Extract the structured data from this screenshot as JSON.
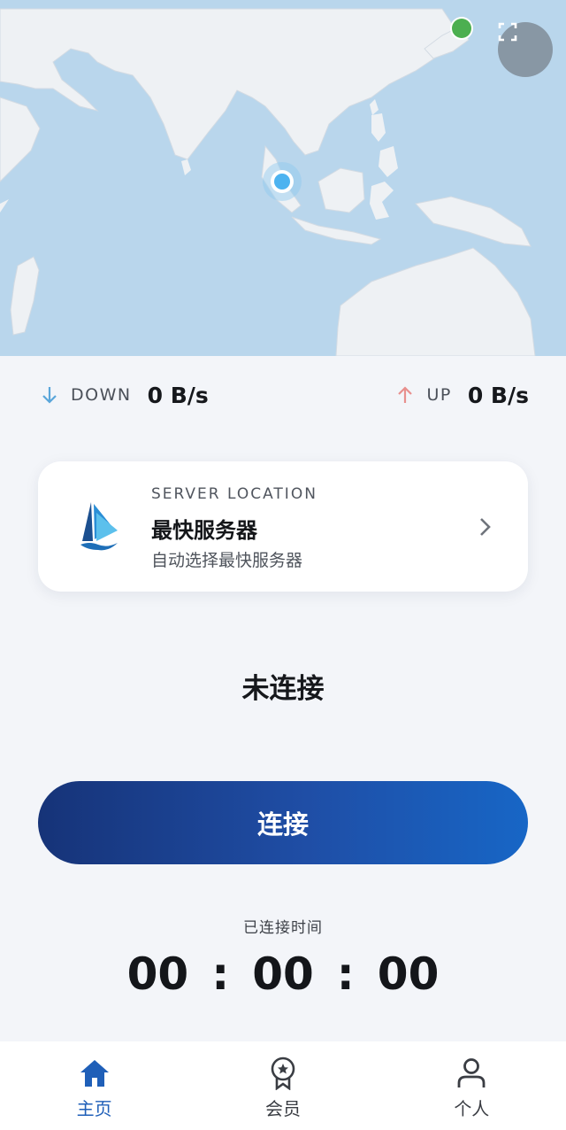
{
  "colors": {
    "accent": "#1f5fb8",
    "map_water": "#b9d6ec",
    "map_land": "#eef1f4",
    "down_arrow": "#5aa6da",
    "up_arrow": "#e8908e",
    "user_location": "#4db3f0",
    "server_location": "#4caf50"
  },
  "map": {
    "fullscreen_icon": "fullscreen-icon"
  },
  "speed": {
    "down_label": "DOWN",
    "down_value": "0 B/s",
    "up_label": "UP",
    "up_value": "0 B/s"
  },
  "server": {
    "caption": "SERVER LOCATION",
    "name": "最快服务器",
    "subtitle": "自动选择最快服务器",
    "logo_icon": "sailboat-logo-icon",
    "chevron_icon": "chevron-right-icon"
  },
  "status": {
    "text": "未连接"
  },
  "connect_button": {
    "label": "连接"
  },
  "timer": {
    "label": "已连接时间",
    "hours": "00",
    "minutes": "00",
    "seconds": "00",
    "separator": ":"
  },
  "nav": {
    "items": [
      {
        "label": "主页",
        "icon": "home-icon",
        "active": true
      },
      {
        "label": "会员",
        "icon": "membership-badge-icon",
        "active": false
      },
      {
        "label": "个人",
        "icon": "person-icon",
        "active": false
      }
    ]
  }
}
